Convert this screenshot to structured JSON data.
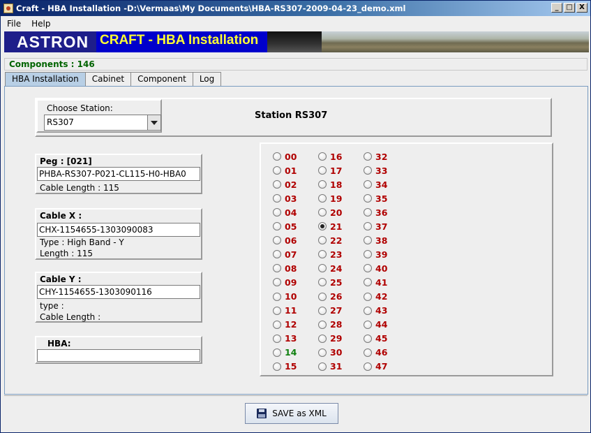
{
  "window": {
    "title": "Craft - HBA Installation -D:\\Vermaas\\My Documents\\HBA-RS307-2009-04-23_demo.xml",
    "buttons": {
      "minimize": "_",
      "maximize": "□",
      "close": "X"
    }
  },
  "menu": {
    "items": [
      "File",
      "Help"
    ]
  },
  "banner": {
    "logo": "ASTRON",
    "title": "CRAFT - HBA Installation",
    "banner_colors": {
      "logo_bg": "#1e1e8a",
      "title_bg": "#0000cc",
      "title_text": "#ffff33"
    }
  },
  "status": {
    "components": "Components : 146"
  },
  "tabs": [
    "HBA Installation",
    "Cabinet",
    "Component",
    "Log"
  ],
  "active_tab": "HBA Installation",
  "station": {
    "choose_label": "Choose Station:",
    "selected": "RS307",
    "title": "Station RS307"
  },
  "peg": {
    "title": "Peg : [021]",
    "value": "PHBA-RS307-P021-CL115-H0-HBA0",
    "cable_length": "Cable Length : 115"
  },
  "cable_x": {
    "title": "Cable X :",
    "value": "CHX-1154655-1303090083",
    "type": "Type : High Band - Y",
    "length": "Length : 115"
  },
  "cable_y": {
    "title": "Cable Y :",
    "value": "CHY-1154655-1303090116",
    "type": "type :",
    "length": "Cable Length :"
  },
  "hba_field": {
    "title": "HBA:",
    "value": ""
  },
  "hba_grid": {
    "columns": [
      [
        "00",
        "01",
        "02",
        "03",
        "04",
        "05",
        "06",
        "07",
        "08",
        "09",
        "10",
        "11",
        "12",
        "13",
        "14",
        "15"
      ],
      [
        "16",
        "17",
        "18",
        "19",
        "20",
        "21",
        "22",
        "23",
        "24",
        "25",
        "26",
        "27",
        "28",
        "29",
        "30",
        "31"
      ],
      [
        "32",
        "33",
        "34",
        "35",
        "36",
        "37",
        "38",
        "39",
        "40",
        "41",
        "42",
        "43",
        "44",
        "45",
        "46",
        "47"
      ]
    ],
    "selected": "21",
    "installed": [
      "14"
    ],
    "colors": {
      "default": "#b00000",
      "installed": "#108010"
    }
  },
  "save_button": {
    "label": "SAVE as XML"
  }
}
